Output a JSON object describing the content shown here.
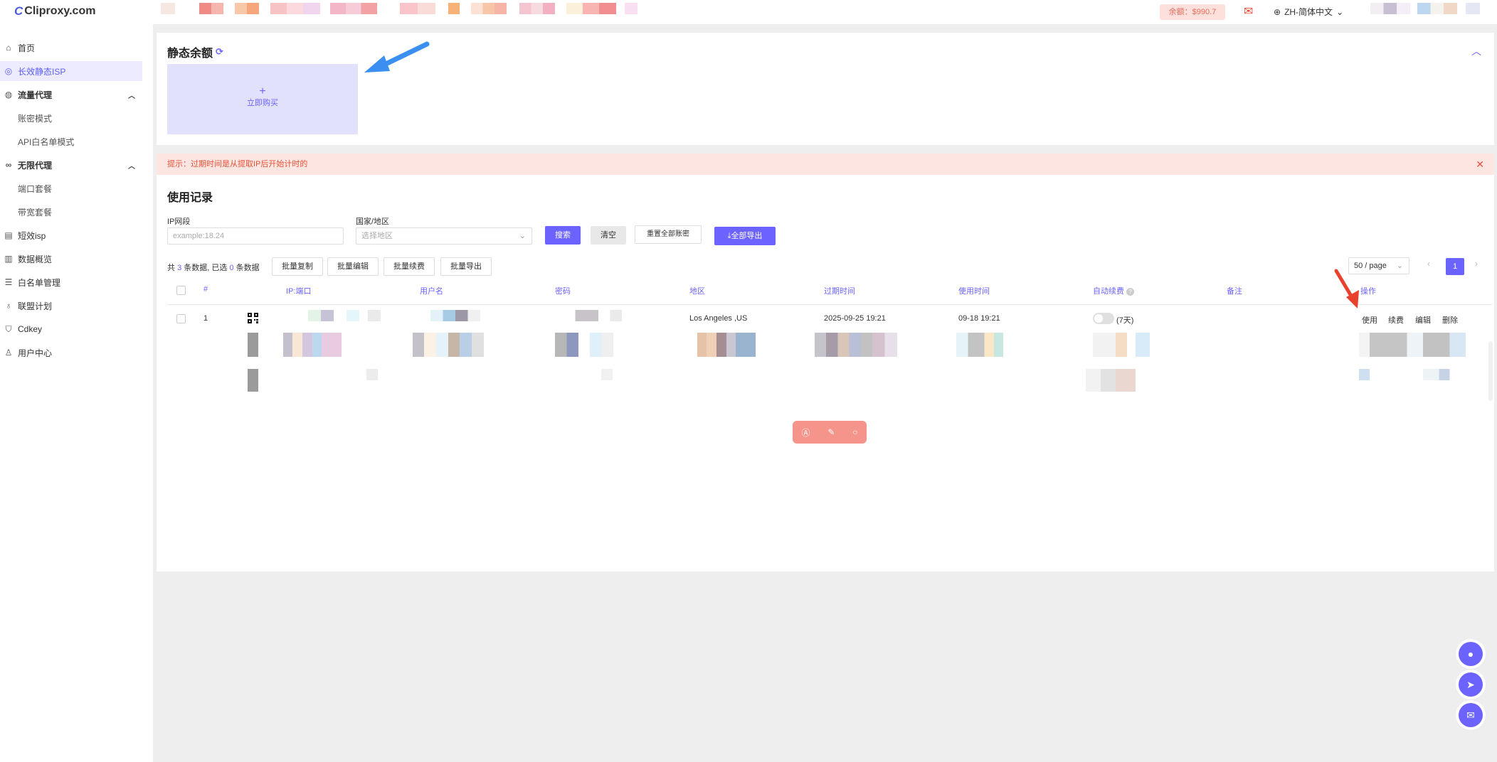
{
  "header": {
    "logo_text": "Cliproxy.com",
    "balance_label": "余额：$990.7",
    "language": "ZH-简体中文"
  },
  "sidebar": {
    "items": [
      {
        "label": "首页",
        "icon": "home-icon"
      },
      {
        "label": "长效静态ISP",
        "icon": "pin-icon"
      },
      {
        "label": "流量代理",
        "icon": "drop-icon"
      },
      {
        "label": "账密模式"
      },
      {
        "label": "API白名单模式"
      },
      {
        "label": "无限代理",
        "icon": "infinity-icon"
      },
      {
        "label": "端口套餐"
      },
      {
        "label": "带宽套餐"
      },
      {
        "label": "短效isp",
        "icon": "chip-icon"
      },
      {
        "label": "数据概览",
        "icon": "chart-icon"
      },
      {
        "label": "白名单管理",
        "icon": "list-icon"
      },
      {
        "label": "联盟计划",
        "icon": "affiliate-icon"
      },
      {
        "label": "Cdkey",
        "icon": "shield-icon"
      },
      {
        "label": "用户中心",
        "icon": "user-icon"
      }
    ]
  },
  "static_balance": {
    "title": "静态余额",
    "buy_label": "立即购买"
  },
  "tip": {
    "text": "提示：过期时间是从提取IP后开始计时的"
  },
  "records": {
    "title": "使用记录",
    "ip_label": "IP网段",
    "ip_placeholder": "example:18.24",
    "country_label": "国家/地区",
    "country_placeholder": "选择地区",
    "search_btn": "搜索",
    "clear_btn": "清空",
    "reset_btn": "重置全部账密",
    "export_all_btn": "全部导出",
    "count_prefix": "共",
    "count_total": "3",
    "count_mid": "条数据, 已选",
    "count_selected": "0",
    "count_suffix": "条数据",
    "bulk_copy": "批量复制",
    "bulk_edit": "批量编辑",
    "bulk_renew": "批量续费",
    "bulk_export": "批量导出",
    "page_size": "50 / page",
    "page": "1",
    "columns": [
      "#",
      "IP:端口",
      "用户名",
      "密码",
      "地区",
      "过期时间",
      "使用时间",
      "自动续费",
      "备注",
      "操作"
    ],
    "row1": {
      "index": "1",
      "region": "Los Angeles ,US",
      "expire": "2025-09-25 19:21",
      "used": "09-18 19:21",
      "auto_renew_days": "(7天)",
      "actions": [
        "使用",
        "续费",
        "编辑",
        "删除"
      ]
    }
  },
  "colors": {
    "accent": "#6c63ff",
    "alert": "#e65138",
    "balance_bg": "#fde0dc"
  }
}
